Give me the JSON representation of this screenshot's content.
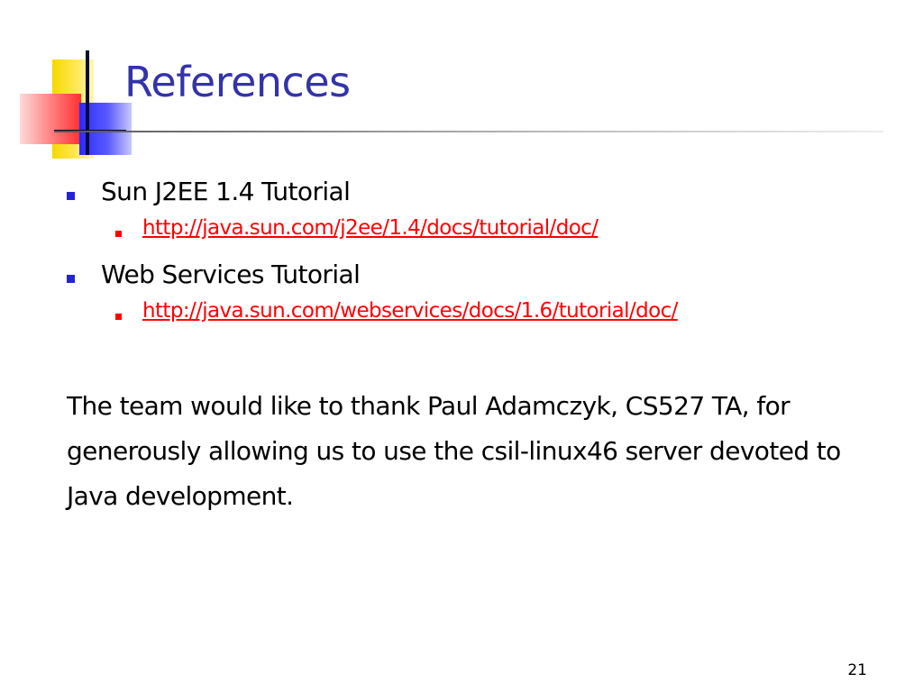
{
  "slide": {
    "title": "References",
    "page_number": "21",
    "references": [
      {
        "label": "Sun J2EE 1.4 Tutorial",
        "link": "http://java.sun.com/j2ee/1.4/docs/tutorial/doc/"
      },
      {
        "label": "Web Services Tutorial",
        "link": "http://java.sun.com/webservices/docs/1.6/tutorial/doc/"
      }
    ],
    "acknowledgement": "The team would like to thank Paul Adamczyk, CS527 TA, for generously allowing us to use the csil-linux46 server devoted to Java development."
  },
  "colors": {
    "title": "#3333aa",
    "bullet": "#2323d9",
    "link": "#ff0000",
    "logo_yellow": "#f5d800",
    "logo_red": "#ff3030",
    "logo_blue": "#2a2aff"
  }
}
